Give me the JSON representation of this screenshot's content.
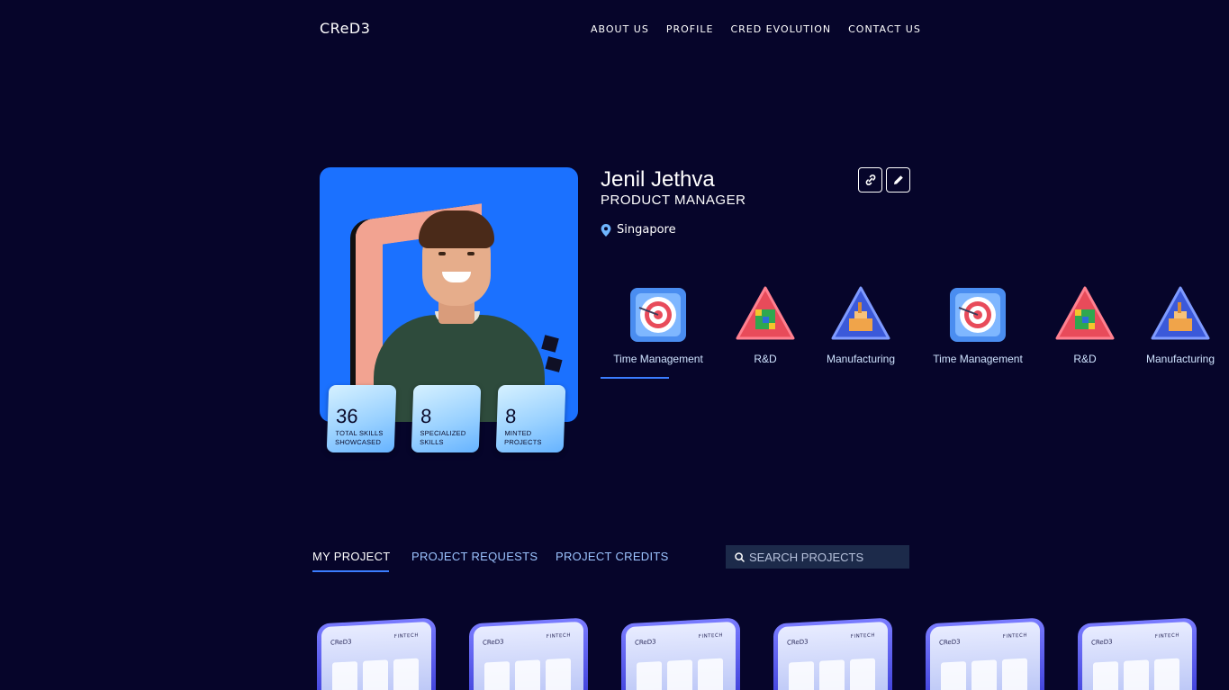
{
  "header": {
    "logo": "CReD3",
    "nav": [
      "ABOUT US",
      "PROFILE",
      "CRED EVOLUTION",
      "CONTACT US"
    ]
  },
  "profile": {
    "name": "Jenil Jethva",
    "role": "PRODUCT MANAGER",
    "location": "Singapore",
    "stats": [
      {
        "value": "36",
        "label": "TOTAL SKILLS SHOWCASED"
      },
      {
        "value": "8",
        "label": "SPECIALIZED SKILLS"
      },
      {
        "value": "8",
        "label": "MINTED PROJECTS"
      }
    ]
  },
  "skills": [
    {
      "label": "Time Management",
      "icon": "target-icon"
    },
    {
      "label": "R&D",
      "icon": "rubiks-cube-icon"
    },
    {
      "label": "Manufacturing",
      "icon": "factory-icon"
    },
    {
      "label": "Time Management",
      "icon": "target-icon"
    },
    {
      "label": "R&D",
      "icon": "rubiks-cube-icon"
    },
    {
      "label": "Manufacturing",
      "icon": "factory-icon"
    }
  ],
  "tabs": {
    "my_project": "MY PROJECT",
    "project_requests": "PROJECT REQUESTS",
    "project_credits": "PROJECT CREDITS"
  },
  "search": {
    "placeholder": "SEARCH PROJECTS"
  },
  "projects": [
    {
      "logo": "CReD3",
      "tag": "FINTECH"
    },
    {
      "logo": "CReD3",
      "tag": "FINTECH"
    },
    {
      "logo": "CReD3",
      "tag": "FINTECH"
    },
    {
      "logo": "CReD3",
      "tag": "FINTECH"
    },
    {
      "logo": "CReD3",
      "tag": "FINTECH"
    },
    {
      "logo": "CReD3",
      "tag": "FINTECH"
    }
  ],
  "colors": {
    "background": "#06052a",
    "accent": "#3b7dff",
    "card_blue": "#1b71ff"
  }
}
